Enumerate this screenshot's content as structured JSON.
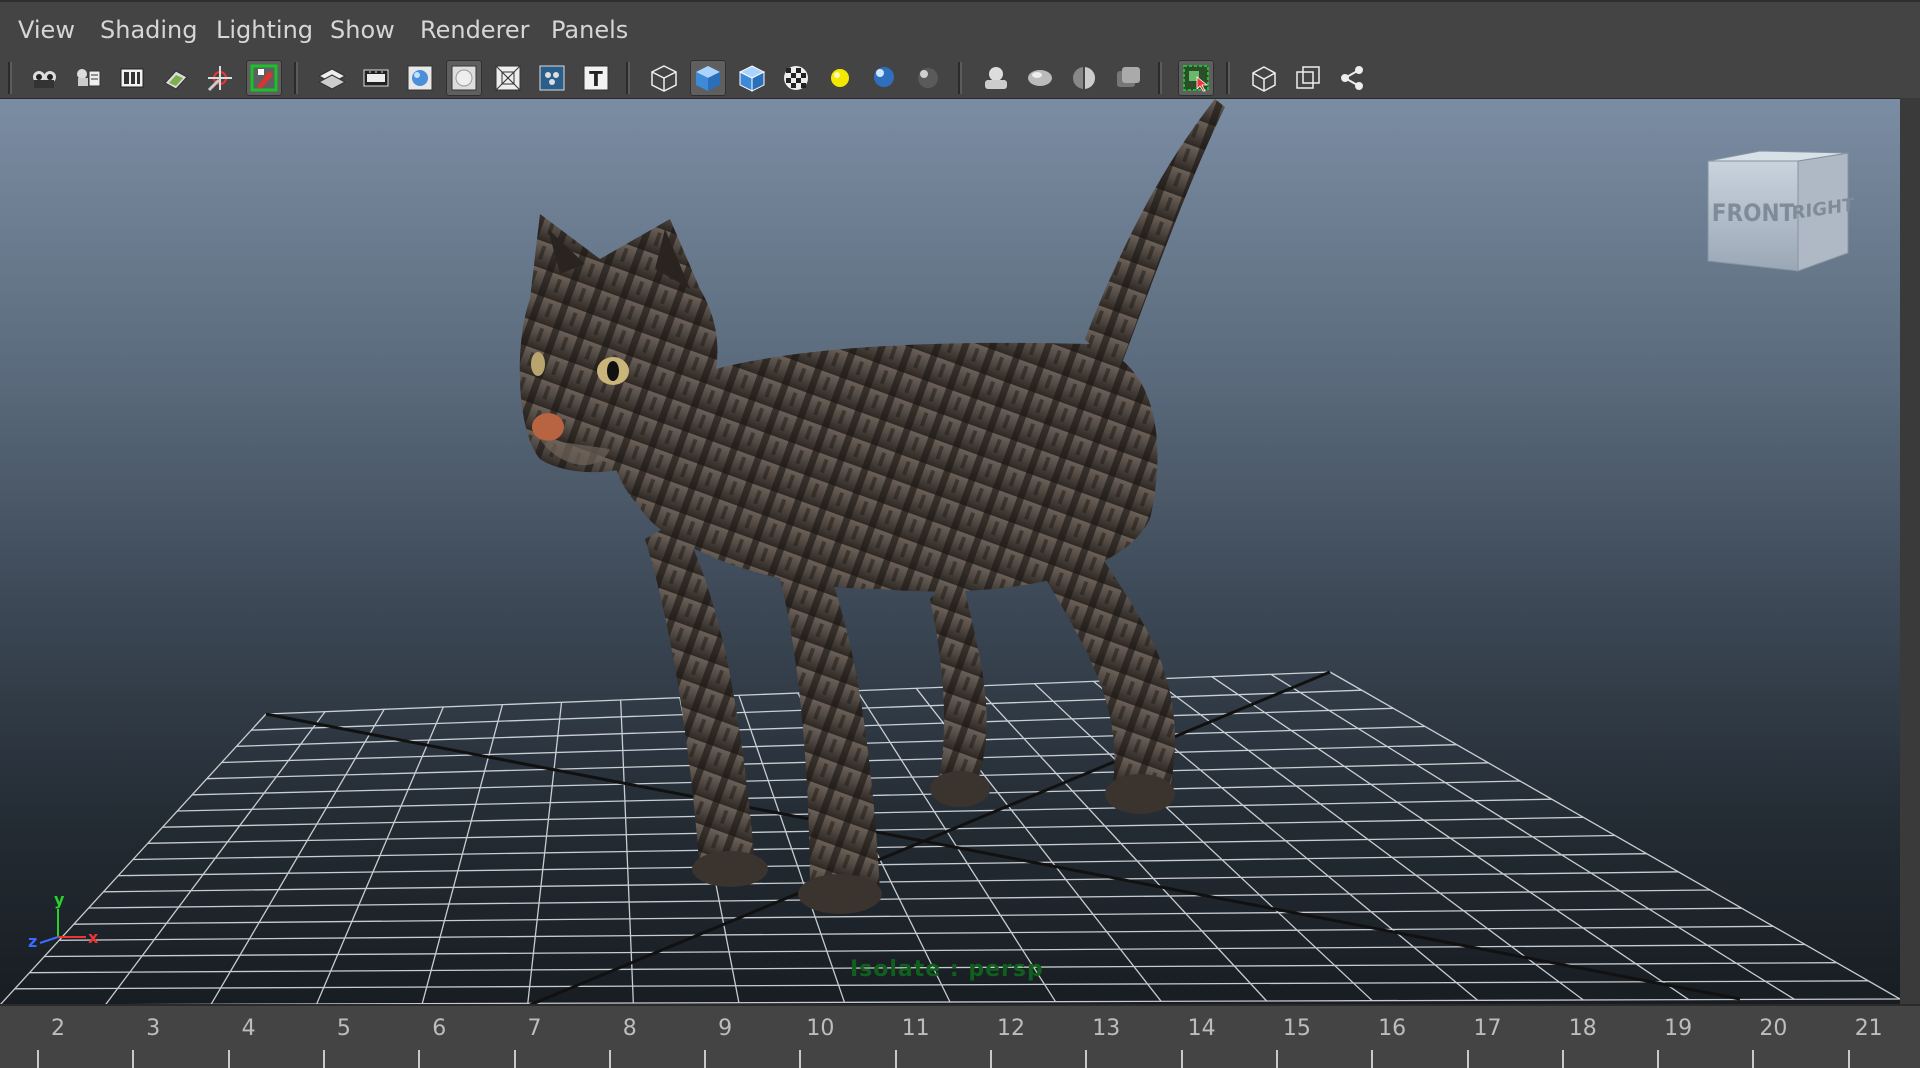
{
  "menu": [
    "View",
    "Shading",
    "Lighting",
    "Show",
    "Renderer",
    "Panels"
  ],
  "toolbar": {
    "groups": [
      [
        "camera-attributes-icon",
        "bookmarks-icon",
        "image-plane-icon",
        "2d-pan-zoom-icon",
        "grease-pencil-icon",
        "select-camera-icon"
      ],
      [
        "grid-icon",
        "film-gate-icon",
        "resolution-gate-icon",
        "gate-mask-icon",
        "field-chart-icon",
        "safe-action-icon",
        "safe-title-icon"
      ],
      [
        "wireframe-icon",
        "smooth-shade-icon",
        "wireframe-on-shaded-icon",
        "textured-icon",
        "use-all-lights-icon",
        "shadows-icon",
        "screen-space-ao-icon"
      ],
      [
        "motion-blur-icon",
        "multisample-aa-icon",
        "depth-of-field-icon",
        "hardware-fog-icon"
      ],
      [
        "isolate-select-icon"
      ],
      [
        "xray-icon",
        "xray-active-components-icon",
        "xray-joints-icon"
      ]
    ],
    "active": [
      "textured-icon",
      "select-camera-icon",
      "isolate-select-icon"
    ]
  },
  "viewport": {
    "view_cube": {
      "front_label": "FRONT",
      "right_label": "RIGHT"
    },
    "axis": {
      "x": "x",
      "y": "y",
      "z": "z"
    },
    "status_text": "Isolate : persp"
  },
  "timeline": {
    "ticks": [
      2,
      3,
      4,
      5,
      6,
      7,
      8,
      9,
      10,
      11,
      12,
      13,
      14,
      15,
      16,
      17,
      18,
      19,
      20,
      21
    ]
  },
  "colors": {
    "ui_bg": "#444444",
    "menu_text": "#d6d6d6",
    "viewport_top": "#7b8da3",
    "viewport_bottom": "#181d22",
    "isolate_text": "#0f5f1d",
    "active_green": "#19c228"
  }
}
